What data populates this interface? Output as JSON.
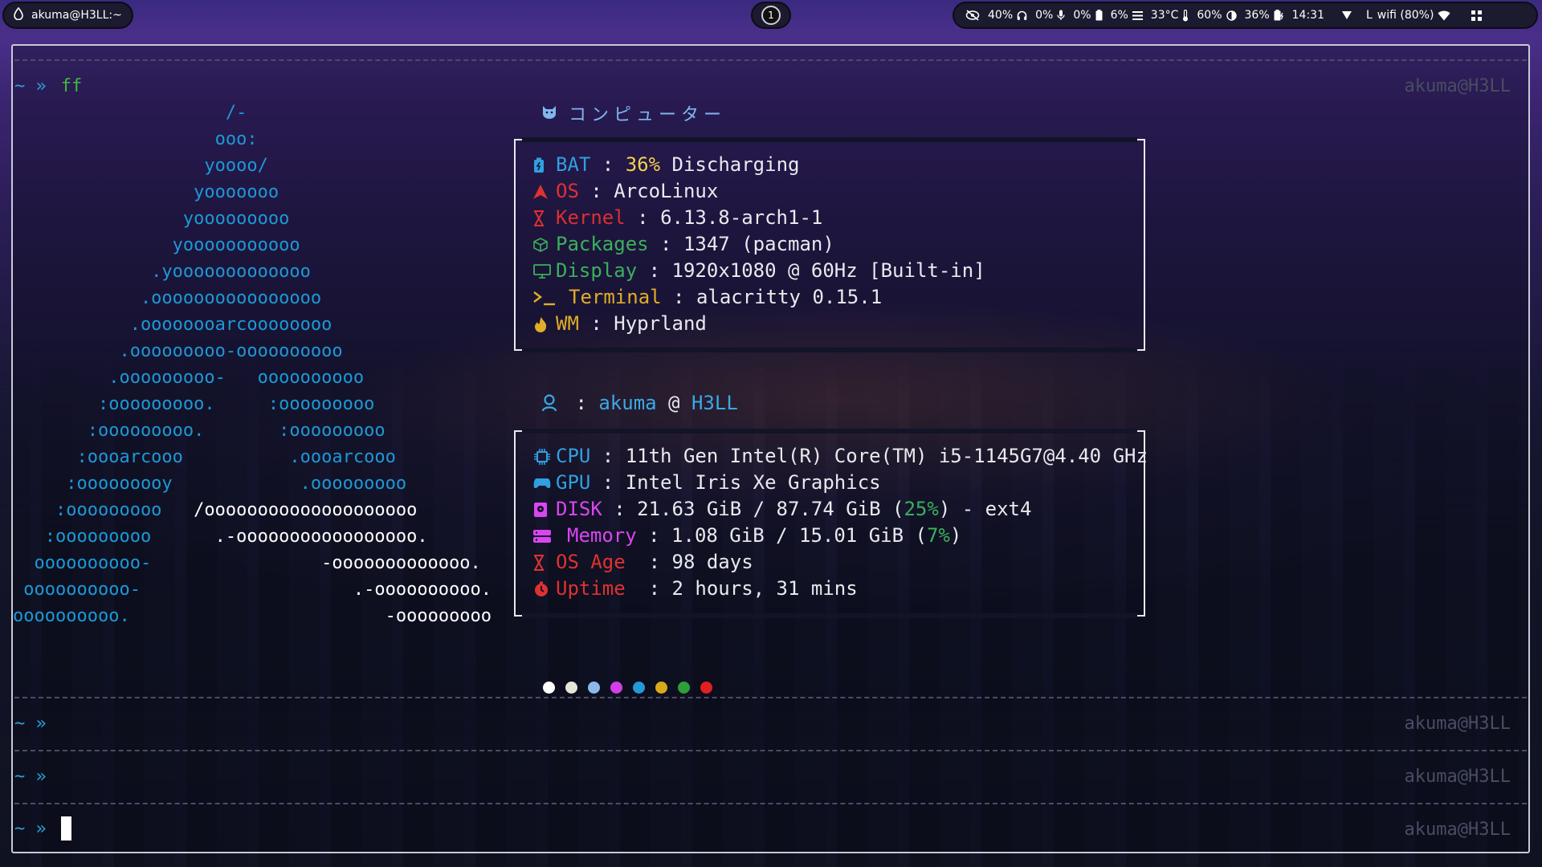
{
  "topbar": {
    "window_title": "akuma@H3LL:~",
    "workspace": "1",
    "status": {
      "cpu": "40%",
      "headphones": "0%",
      "mic": "0%",
      "battery_small": "6%",
      "temp": "33°C",
      "brightness": "60%",
      "battery": "36%",
      "clock": "14:31",
      "layout": "L",
      "wifi": "wifi (80%)"
    }
  },
  "terminal": {
    "prompt_symbol": "~ »",
    "command": "ff",
    "host": "akuma@H3LL",
    "ascii_art": [
      "                    /-",
      "                   ooo:",
      "                  yoooo/",
      "                 yooooooo",
      "                yooooooooo",
      "               yooooooooooo",
      "             .yooooooooooooo",
      "            .oooooooooooooooo",
      "           .oooooooarcoooooooo",
      "          .ooooooooo-oooooooooo",
      "         .ooooooooo-   oooooooooo",
      "        :ooooooooo.     :ooooooooo",
      "       :ooooooooo.       :ooooooooo",
      "      :oooarcooo          .oooarcooo",
      "     :ooooooooy            .ooooooooo",
      "    :ooooooooo   ",
      "   :ooooooooo      ",
      "  oooooooooo-                ",
      " oooooooooo-                    ",
      "oooooooooo.                        "
    ],
    "ascii_white_tails": [
      "",
      "",
      "",
      "",
      "",
      "",
      "",
      "",
      "",
      "",
      "",
      "",
      "",
      "",
      "",
      "/oooooooooooooooooooo",
      ".-ooooooooooooooooo.",
      "-ooooooooooooo.",
      ".-oooooooooo.",
      "-ooooooooo"
    ],
    "fetch": {
      "title": "コンピューター",
      "system": [
        {
          "key": "BAT",
          "sep": " : ",
          "value_hl": "36%",
          "value": " Discharging"
        },
        {
          "key": "OS",
          "sep": " : ",
          "value_hl": "",
          "value": "ArcoLinux"
        },
        {
          "key": "Kernel",
          "sep": " : ",
          "value_hl": "",
          "value": "6.13.8-arch1-1"
        },
        {
          "key": "Packages",
          "sep": " : ",
          "value_hl": "",
          "value": "1347 (pacman)"
        },
        {
          "key": "Display",
          "sep": " : ",
          "value_hl": "",
          "value": "1920x1080 @ 60Hz [Built-in]"
        },
        {
          "key": "Terminal",
          "sep": " : ",
          "value_hl": "",
          "value": "alacritty 0.15.1"
        },
        {
          "key": "WM",
          "sep": " : ",
          "value_hl": "",
          "value": "Hyprland"
        }
      ],
      "user": {
        "sep": " : ",
        "name": "akuma",
        "at": " @ ",
        "host": "H3LL"
      },
      "hardware": {
        "cpu": {
          "key": "CPU",
          "value": " : 11th Gen Intel(R) Core(TM) i5-1145G7@4.40 GHz"
        },
        "gpu": {
          "key": "GPU",
          "value": " : Intel Iris Xe Graphics"
        },
        "disk": {
          "key": "DISK",
          "pre": " : 21.63 GiB / 87.74 GiB (",
          "pct": "25%",
          "post": ") - ext4"
        },
        "memory": {
          "key": "Memory",
          "pre": " : 1.08 GiB / 15.01 GiB (",
          "pct": "7%",
          "post": ")"
        },
        "age": {
          "key": "OS Age",
          "value": "  : 98 days"
        },
        "uptime": {
          "key": "Uptime",
          "value": "  : 2 hours, 31 mins"
        }
      },
      "palette": [
        "#ffffff",
        "#e6e6d8",
        "#8fb8ea",
        "#d23fe8",
        "#2499d6",
        "#d8aa1a",
        "#2f9e3a",
        "#e02020"
      ]
    }
  }
}
